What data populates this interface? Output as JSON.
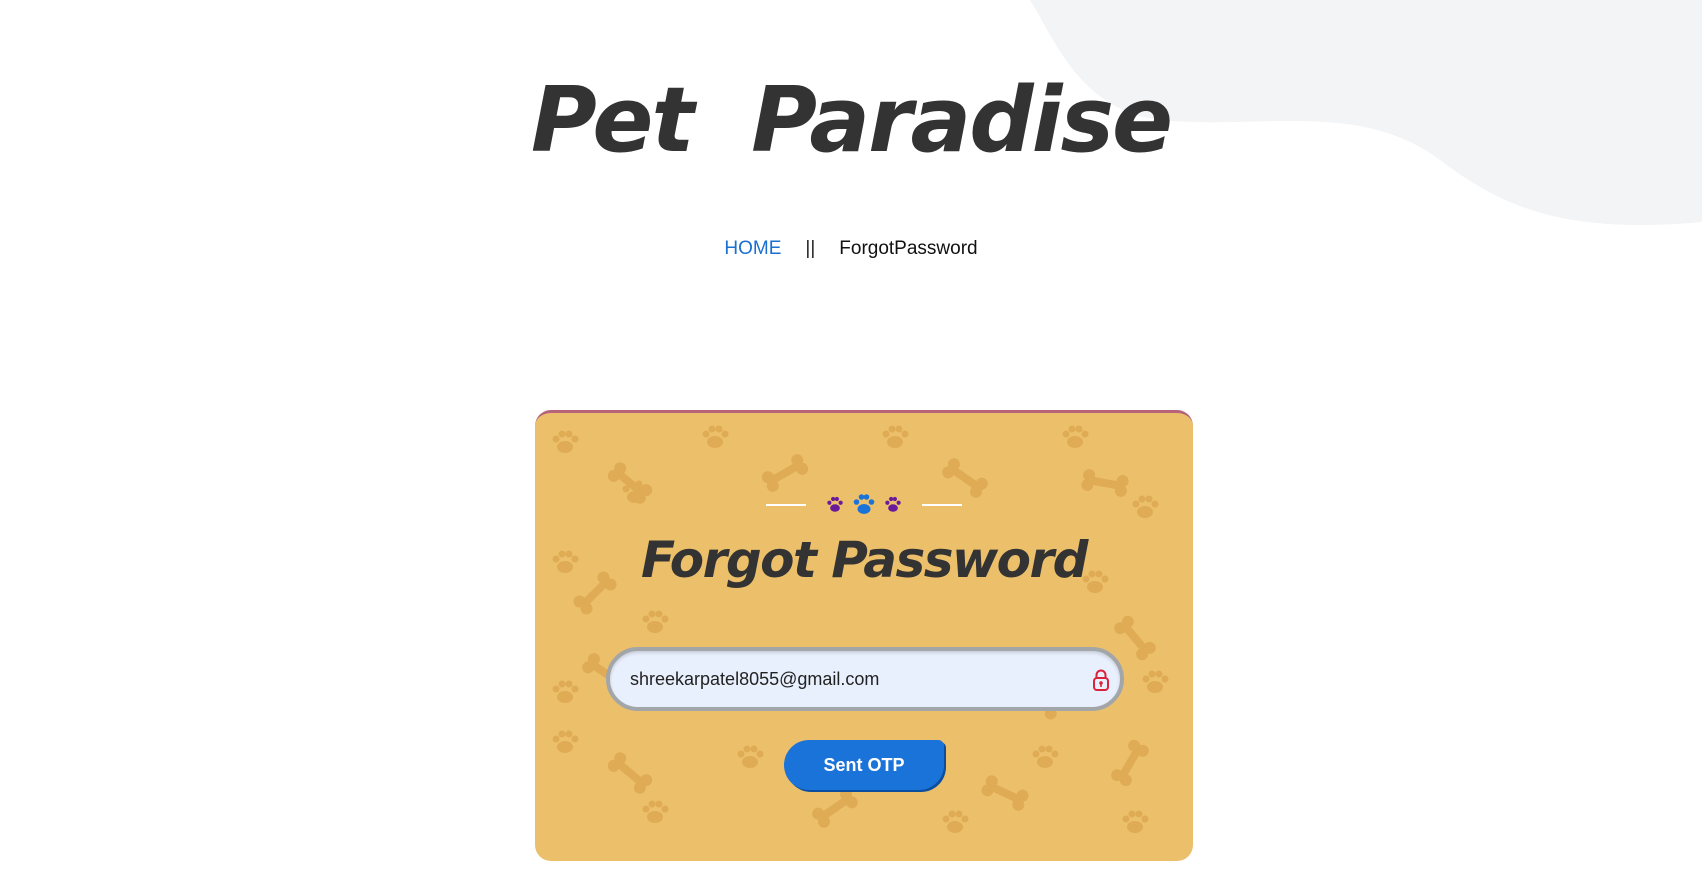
{
  "site": {
    "title": "Pet  Paradise"
  },
  "breadcrumb": {
    "home": "HOME",
    "separator": "||",
    "current": "ForgotPassword"
  },
  "form": {
    "title": "Forgot Password",
    "email_value": "shreekarpatel8055@gmail.com",
    "submit_label": "Sent OTP"
  },
  "colors": {
    "card_background": "#ecc06a",
    "card_top_border": "#b7637a",
    "link": "#1a6fd1",
    "button": "#1a73d9",
    "paw_purple": "#6a1b9a",
    "paw_blue": "#1a73d9",
    "lock_icon": "#d8233b"
  },
  "icons": {
    "divider": [
      "paw-icon",
      "paw-icon",
      "paw-icon"
    ],
    "email_field": "lock-icon"
  }
}
